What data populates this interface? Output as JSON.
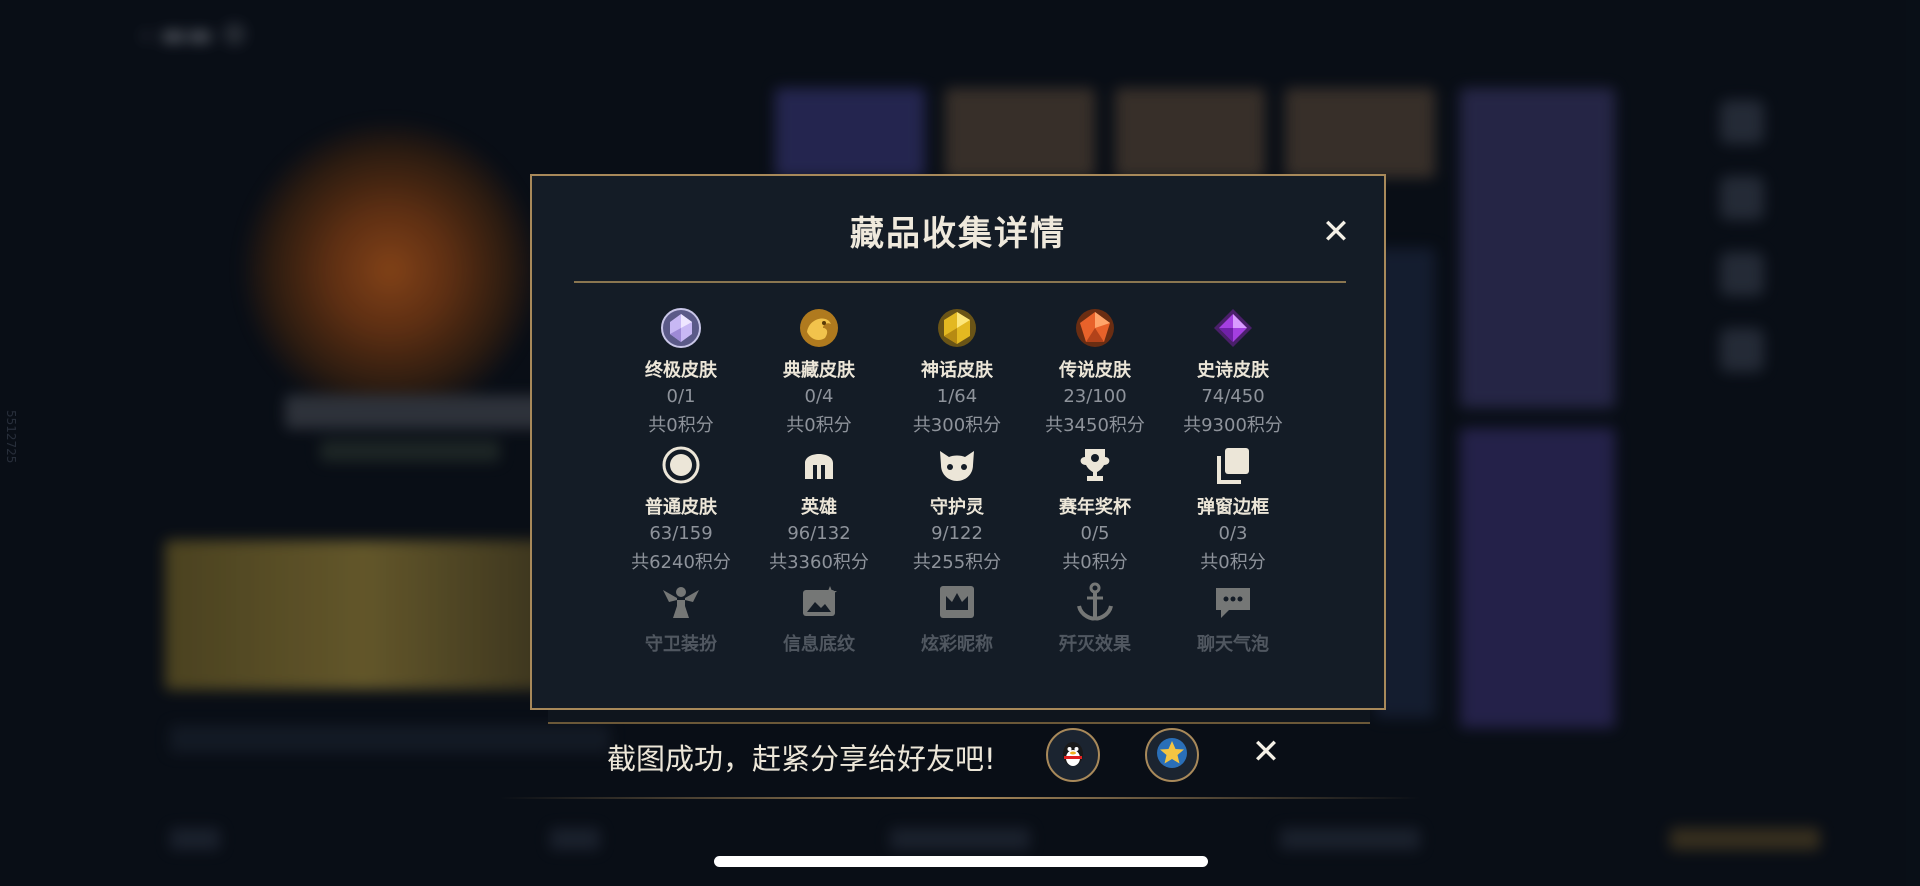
{
  "modal": {
    "title": "藏品收集详情",
    "rows": [
      [
        {
          "label": "终极皮肤",
          "count": "0/1",
          "points": "共0积分",
          "icon": "ultimate-gem-icon"
        },
        {
          "label": "典藏皮肤",
          "count": "0/4",
          "points": "共0积分",
          "icon": "dragon-emblem-icon"
        },
        {
          "label": "神话皮肤",
          "count": "1/64",
          "points": "共300积分",
          "icon": "gold-gem-icon"
        },
        {
          "label": "传说皮肤",
          "count": "23/100",
          "points": "共3450积分",
          "icon": "orange-gem-icon"
        },
        {
          "label": "史诗皮肤",
          "count": "74/450",
          "points": "共9300积分",
          "icon": "purple-gem-icon"
        }
      ],
      [
        {
          "label": "普通皮肤",
          "count": "63/159",
          "points": "共6240积分",
          "icon": "ring-icon"
        },
        {
          "label": "英雄",
          "count": "96/132",
          "points": "共3360积分",
          "icon": "helmet-icon"
        },
        {
          "label": "守护灵",
          "count": "9/122",
          "points": "共255积分",
          "icon": "pet-face-icon"
        },
        {
          "label": "赛年奖杯",
          "count": "0/5",
          "points": "共0积分",
          "icon": "trophy-icon"
        },
        {
          "label": "弹窗边框",
          "count": "0/3",
          "points": "共0积分",
          "icon": "frames-icon"
        }
      ],
      [
        {
          "label": "守卫装扮",
          "icon": "guard-costume-icon"
        },
        {
          "label": "信息底纹",
          "icon": "info-card-icon"
        },
        {
          "label": "炫彩昵称",
          "icon": "crown-nameplate-icon"
        },
        {
          "label": "歼灭效果",
          "icon": "anchor-icon"
        },
        {
          "label": "聊天气泡",
          "icon": "chat-bubble-icon"
        }
      ]
    ]
  },
  "share": {
    "message": "截图成功，赶紧分享给好友吧!",
    "buttons": [
      {
        "icon": "qq-penguin-icon"
      },
      {
        "icon": "star-badge-icon"
      }
    ]
  },
  "background": {
    "side_id": "5512725"
  },
  "colors": {
    "accent_gold": "#a8895a",
    "panel": "#141c26",
    "text_muted": "#8e939b"
  }
}
